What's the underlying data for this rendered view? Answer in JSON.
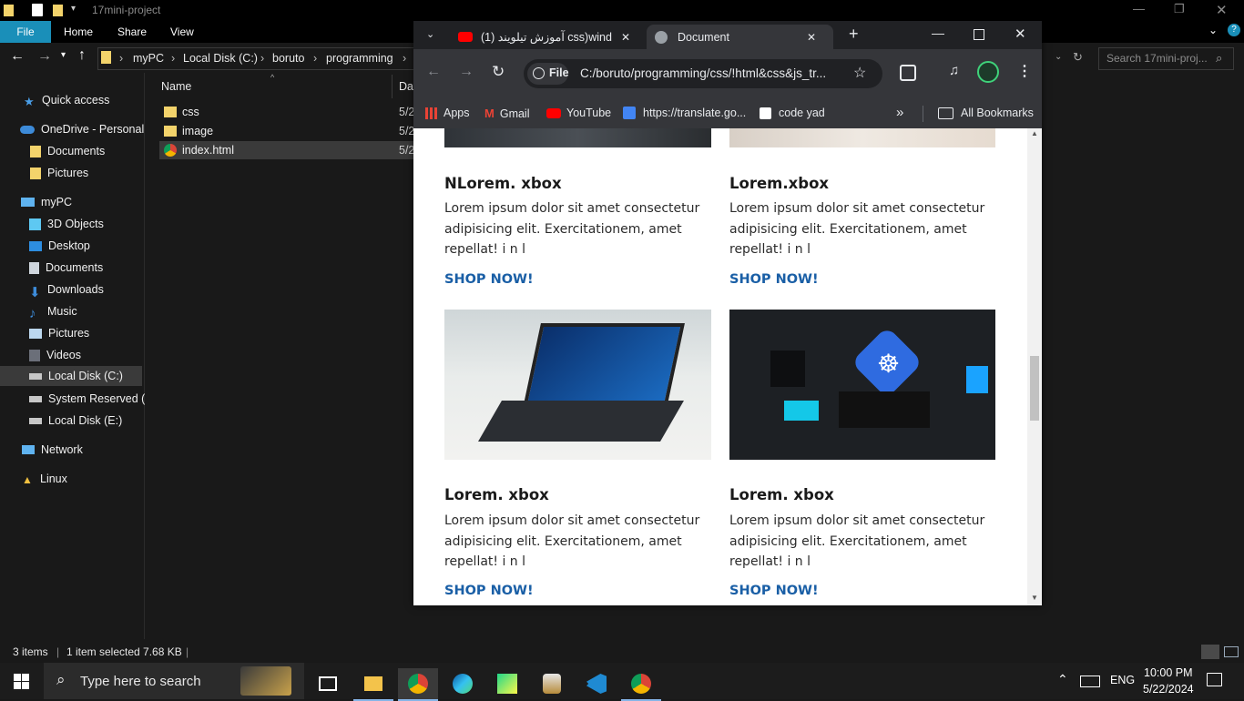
{
  "explorer": {
    "title": "17mini-project",
    "ribbon": {
      "file": "File",
      "tabs": [
        "Home",
        "Share",
        "View"
      ]
    },
    "breadcrumb": [
      "myPC",
      "Local Disk (C:)",
      "boruto",
      "programming"
    ],
    "search_placeholder": "Search 17mini-proj...",
    "nav": {
      "quick_access": "Quick access",
      "onedrive": "OneDrive - Personal",
      "onedrive_items": [
        "Documents",
        "Pictures"
      ],
      "mypc": "myPC",
      "mypc_items": [
        "3D Objects",
        "Desktop",
        "Documents",
        "Downloads",
        "Music",
        "Pictures",
        "Videos",
        "Local Disk (C:)",
        "System Reserved (D",
        "Local Disk (E:)"
      ],
      "network": "Network",
      "linux": "Linux"
    },
    "columns": {
      "name": "Name",
      "date": "Dat"
    },
    "files": [
      {
        "name": "css",
        "date": "5/2"
      },
      {
        "name": "image",
        "date": "5/2"
      },
      {
        "name": "index.html",
        "date": "5/2"
      }
    ],
    "status": {
      "items": "3 items",
      "selected": "1 item selected  7.68 KB"
    }
  },
  "chrome": {
    "tabs": [
      {
        "label": "(1) آموزش تیلویند css)wind"
      },
      {
        "label": "Document"
      }
    ],
    "omnibox": {
      "chip": "File",
      "url": "C:/boruto/programming/css/!html&css&js_tr..."
    },
    "bookmarks": [
      "Apps",
      "Gmail",
      "YouTube",
      "https://translate.go...",
      "code yad"
    ],
    "all_bookmarks": "All Bookmarks",
    "cards": [
      {
        "title": "NLorem. xbox",
        "desc": "Lorem ipsum dolor sit amet consectetur adipisicing elit. Exercitationem, amet repellat! i n l",
        "cta": "SHOP NOW!"
      },
      {
        "title": "Lorem.xbox",
        "desc": "Lorem ipsum dolor sit amet consectetur adipisicing elit. Exercitationem, amet repellat! i n l",
        "cta": "SHOP NOW!"
      },
      {
        "title": "Lorem. xbox",
        "desc": "Lorem ipsum dolor sit amet consectetur adipisicing elit. Exercitationem, amet repellat! i n l",
        "cta": "SHOP NOW!"
      },
      {
        "title": "Lorem. xbox",
        "desc": "Lorem ipsum dolor sit amet consectetur adipisicing elit. Exercitationem, amet repellat! i n l",
        "cta": "SHOP NOW!"
      }
    ]
  },
  "taskbar": {
    "search_placeholder": "Type here to search",
    "lang": "ENG",
    "time": "10:00 PM",
    "date": "5/22/2024"
  }
}
